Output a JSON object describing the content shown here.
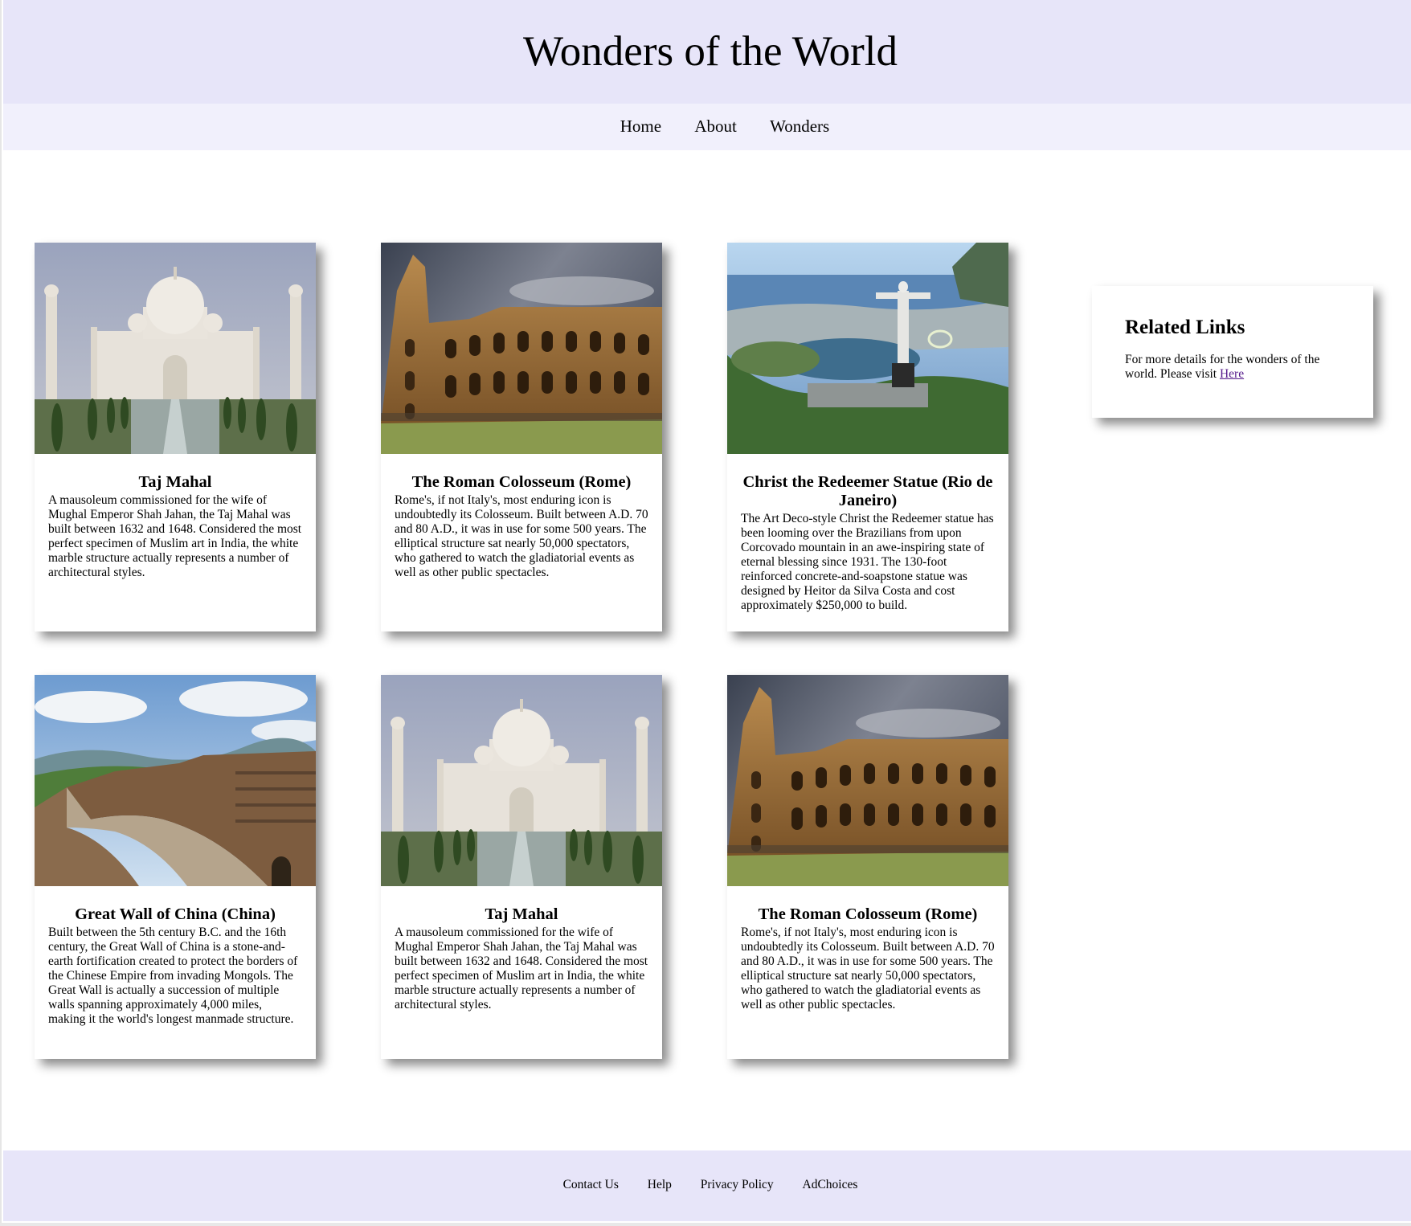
{
  "header": {
    "title": "Wonders of the World"
  },
  "nav": {
    "items": [
      "Home",
      "About",
      "Wonders"
    ]
  },
  "cards": [
    {
      "title": "Taj Mahal",
      "image": "taj-mahal",
      "text": "A mausoleum commissioned for the wife of Mughal Emperor Shah Jahan, the Taj Mahal was built between 1632 and 1648. Considered the most perfect specimen of Muslim art in India, the white marble structure actually represents a number of architectural styles."
    },
    {
      "title": "The Roman Colosseum (Rome)",
      "image": "colosseum",
      "text": "Rome's, if not Italy's, most enduring icon is undoubtedly its Colosseum. Built between A.D. 70 and 80 A.D., it was in use for some 500 years. The elliptical structure sat nearly 50,000 spectators, who gathered to watch the gladiatorial events as well as other public spectacles."
    },
    {
      "title": "Christ the Redeemer Statue (Rio de Janeiro)",
      "image": "christ-redeemer",
      "text": "The Art Deco-style Christ the Redeemer statue has been looming over the Brazilians from upon Corcovado mountain in an awe-inspiring state of eternal blessing since 1931. The 130-foot reinforced concrete-and-soapstone statue was designed by Heitor da Silva Costa and cost approximately $250,000 to build."
    },
    {
      "title": "Great Wall of China (China)",
      "image": "great-wall",
      "text": "Built between the 5th century B.C. and the 16th century, the Great Wall of China is a stone-and-earth fortification created to protect the borders of the Chinese Empire from invading Mongols. The Great Wall is actually a succession of multiple walls spanning approximately 4,000 miles, making it the world's longest manmade structure."
    },
    {
      "title": "Taj Mahal",
      "image": "taj-mahal",
      "text": "A mausoleum commissioned for the wife of Mughal Emperor Shah Jahan, the Taj Mahal was built between 1632 and 1648. Considered the most perfect specimen of Muslim art in India, the white marble structure actually represents a number of architectural styles."
    },
    {
      "title": "The Roman Colosseum (Rome)",
      "image": "colosseum",
      "text": "Rome's, if not Italy's, most enduring icon is undoubtedly its Colosseum. Built between A.D. 70 and 80 A.D., it was in use for some 500 years. The elliptical structure sat nearly 50,000 spectators, who gathered to watch the gladiatorial events as well as other public spectacles."
    }
  ],
  "related": {
    "title": "Related Links",
    "text": "For more details for the wonders of the world. Please visit",
    "link_label": "Here"
  },
  "footer": {
    "links": [
      "Contact Us",
      "Help",
      "Privacy Policy",
      "AdChoices"
    ]
  },
  "colors": {
    "header_bg": "#e7e5f9",
    "nav_bg": "#f1f0fc",
    "footer_bg": "#e7e5f9",
    "link_visited": "#551a8b"
  }
}
